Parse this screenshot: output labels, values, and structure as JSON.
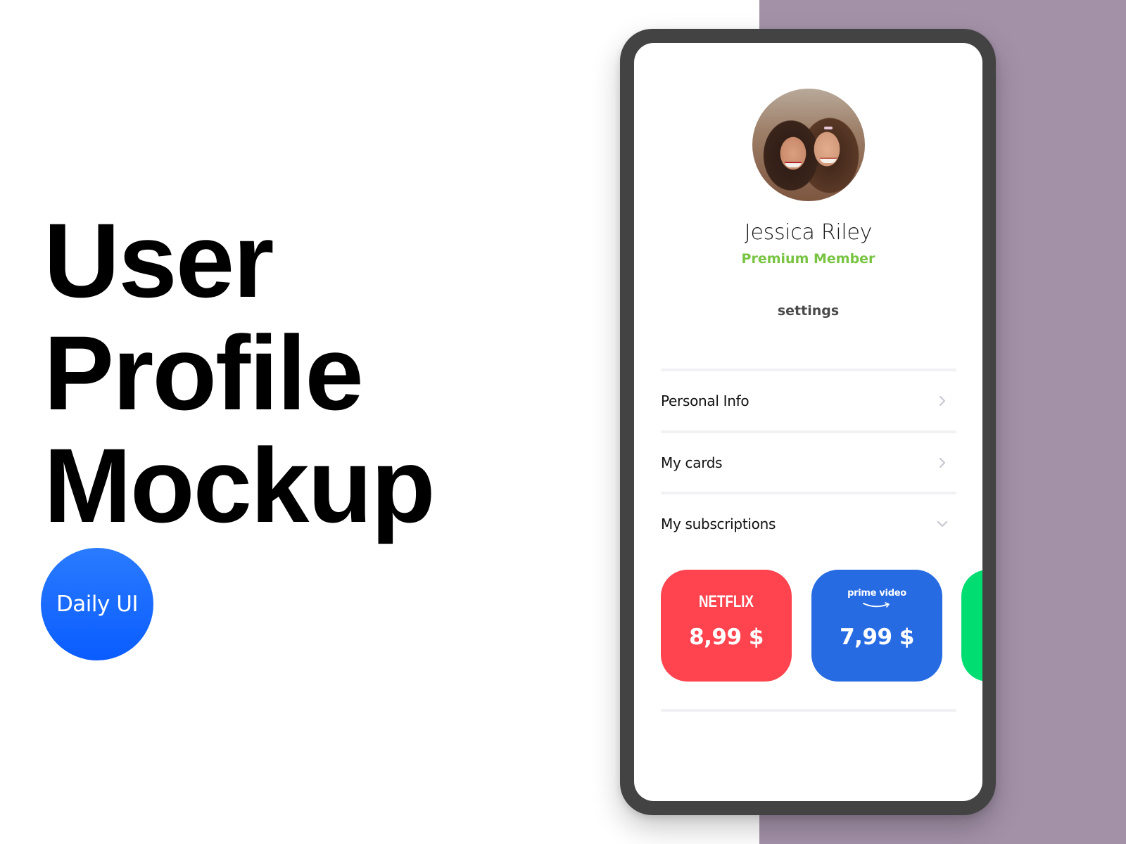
{
  "headline": {
    "lines": [
      "User",
      "Profile",
      "Mockup"
    ]
  },
  "badge": {
    "label": "Daily UI",
    "color": "#0a5cff"
  },
  "background": {
    "accent_panel_color": "#a391a8"
  },
  "profile": {
    "avatar_icon": "user-photo",
    "name": "Jessica Riley",
    "membership": "Premium Member",
    "membership_color": "#78c442",
    "settings_label": "settings"
  },
  "menu": {
    "items": [
      {
        "label": "Personal Info",
        "icon": "chevron-right-icon"
      },
      {
        "label": "My cards",
        "icon": "chevron-right-icon"
      },
      {
        "label": "My subscriptions",
        "icon": "chevron-down-icon",
        "expanded": true
      }
    ]
  },
  "subscriptions": [
    {
      "service": "NETFLIX",
      "price": "8,99 $",
      "color": "#ff444f"
    },
    {
      "service": "prime video",
      "price": "7,99 $",
      "color": "#276be3"
    },
    {
      "service": "",
      "price": "",
      "color": "#02dd72"
    }
  ]
}
